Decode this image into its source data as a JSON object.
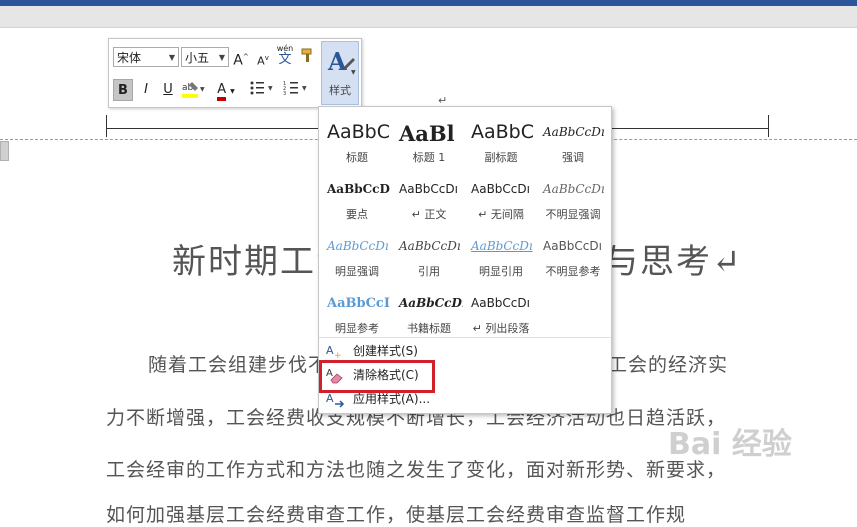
{
  "toolbar": {
    "font_name": "宋体",
    "font_size": "小五",
    "grow_font": "A",
    "shrink_font": "A",
    "phonetic": "wén",
    "phonetic_char": "文",
    "bold": "B",
    "italic": "I",
    "underline": "U",
    "font_color_letter": "A",
    "styles_label": "样式"
  },
  "gallery": {
    "styles": [
      {
        "sample": "AaBbC",
        "name": "标题"
      },
      {
        "sample": "AaBl",
        "name": "标题 1"
      },
      {
        "sample": "AaBbC",
        "name": "副标题"
      },
      {
        "sample": "AaBbCcDı",
        "name": "强调"
      },
      {
        "sample": "AaBbCcD",
        "name": "要点"
      },
      {
        "sample": "AaBbCcDı",
        "name": "↵ 正文"
      },
      {
        "sample": "AaBbCcDı",
        "name": "↵ 无间隔"
      },
      {
        "sample": "AaBbCcDı",
        "name": "不明显强调"
      },
      {
        "sample": "AaBbCcDı",
        "name": "明显强调"
      },
      {
        "sample": "AaBbCcDı",
        "name": "引用"
      },
      {
        "sample": "AaBbCcDı",
        "name": "明显引用"
      },
      {
        "sample": "AaBbCcDı",
        "name": "不明显参考"
      },
      {
        "sample": "AaBbCcI",
        "name": "明显参考"
      },
      {
        "sample": "AaBbCcDı",
        "name": "书籍标题"
      },
      {
        "sample": "AaBbCcDı",
        "name": "↵ 列出段落"
      }
    ],
    "menu": {
      "create": "创建样式(S)",
      "clear": "清除格式(C)",
      "apply": "应用样式(A)..."
    }
  },
  "document": {
    "para_mark": "↵",
    "title": "新时期工会经审工作的实践与思考↵",
    "lines": [
      "随着工会组建步伐不断加快，工会会员人数的增加，工会的经济实",
      "力不断增强，工会经费收支规模不断增长，工会经济活动也日趋活跃，",
      "工会经审的工作方式和方法也随之发生了变化，面对新形势、新要求，",
      "如何加强基层工会经费审查工作，使基层工会经费审查监督工作规"
    ]
  },
  "watermark": "Bai 经验",
  "colors": {
    "accent": "#2b579a",
    "highlight": "#d0202a",
    "styles_button": "#d5e1f2"
  }
}
